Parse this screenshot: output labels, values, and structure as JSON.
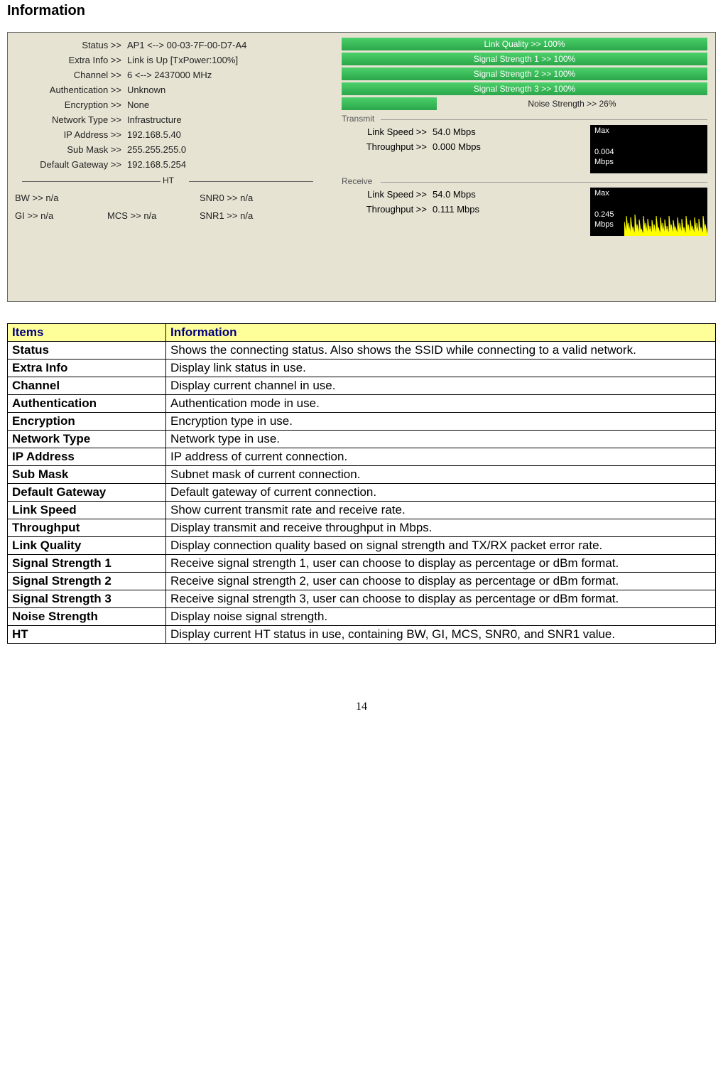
{
  "title": "Information",
  "page_number": "14",
  "screenshot": {
    "left_kv": [
      {
        "label": "Status >>",
        "value": "AP1 <--> 00-03-7F-00-D7-A4"
      },
      {
        "label": "Extra Info >>",
        "value": "Link is Up [TxPower:100%]"
      },
      {
        "label": "Channel >>",
        "value": "6 <--> 2437000 MHz"
      },
      {
        "label": "Authentication >>",
        "value": "Unknown"
      },
      {
        "label": "Encryption >>",
        "value": "None"
      },
      {
        "label": "Network Type >>",
        "value": "Infrastructure"
      },
      {
        "label": "IP Address >>",
        "value": "192.168.5.40"
      },
      {
        "label": "Sub Mask >>",
        "value": "255.255.255.0"
      },
      {
        "label": "Default Gateway >>",
        "value": "192.168.5.254"
      }
    ],
    "ht_label": "HT",
    "ht": {
      "bw": {
        "label": "BW >>",
        "value": "n/a"
      },
      "snr0": {
        "label": "SNR0 >>",
        "value": "n/a"
      },
      "gi": {
        "label": "GI >>",
        "value": "n/a"
      },
      "mcs": {
        "label": "MCS >>",
        "value": "n/a"
      },
      "snr1": {
        "label": "SNR1 >>",
        "value": "n/a"
      }
    },
    "bars": {
      "link_quality": "Link Quality >> 100%",
      "sig1": "Signal Strength 1 >> 100%",
      "sig2": "Signal Strength 2 >> 100%",
      "sig3": "Signal Strength 3 >> 100%",
      "noise": "Noise Strength >> 26%"
    },
    "transmit": {
      "legend": "Transmit",
      "link_speed": {
        "label": "Link Speed >>",
        "value": "54.0 Mbps"
      },
      "throughput": {
        "label": "Throughput >>",
        "value": "0.000 Mbps"
      },
      "chart": {
        "max": "Max",
        "value": "0.004",
        "unit": "Mbps"
      }
    },
    "receive": {
      "legend": "Receive",
      "link_speed": {
        "label": "Link Speed >>",
        "value": "54.0 Mbps"
      },
      "throughput": {
        "label": "Throughput >>",
        "value": "0.111 Mbps"
      },
      "chart": {
        "max": "Max",
        "value": "0.245",
        "unit": "Mbps"
      }
    }
  },
  "table": {
    "header": {
      "items": "Items",
      "info": "Information"
    },
    "rows": [
      {
        "item": "Status",
        "info": "Shows the connecting status. Also shows the SSID while connecting to a valid network.",
        "justify": false
      },
      {
        "item": "Extra Info",
        "info": "Display link status in use.",
        "justify": false
      },
      {
        "item": "Channel",
        "info": "Display current channel in use.",
        "justify": false
      },
      {
        "item": "Authentication",
        "info": "Authentication mode in use.",
        "justify": false
      },
      {
        "item": "Encryption",
        "info": "Encryption type in use.",
        "justify": false
      },
      {
        "item": "Network Type",
        "info": "Network type in use.",
        "justify": false
      },
      {
        "item": "IP Address",
        "info": "IP address of current connection.",
        "justify": false
      },
      {
        "item": "Sub Mask",
        "info": "Subnet mask of current connection.",
        "justify": false
      },
      {
        "item": "Default Gateway",
        "info": "Default gateway of current connection.",
        "justify": false
      },
      {
        "item": "Link Speed",
        "info": "Show current transmit rate and receive rate.",
        "justify": false
      },
      {
        "item": "Throughput",
        "info": "Display transmit and receive throughput in Mbps.",
        "justify": false
      },
      {
        "item": "Link Quality",
        "info": "Display connection quality based on signal strength and TX/RX packet error rate.",
        "justify": true
      },
      {
        "item": "Signal Strength 1",
        "info": "Receive signal strength 1, user can choose to display as percentage or dBm format.",
        "justify": true
      },
      {
        "item": "Signal Strength 2",
        "info": "Receive signal strength 2, user can choose to display as percentage or dBm format.",
        "justify": true
      },
      {
        "item": "Signal Strength 3",
        "info": "Receive signal strength 3, user can choose to display as percentage or dBm format.",
        "justify": true
      },
      {
        "item": "Noise Strength",
        "info": "Display noise signal strength.",
        "justify": false
      },
      {
        "item": "HT",
        "info": "Display current HT status in use, containing BW, GI, MCS, SNR0, and SNR1 value.",
        "justify": true
      }
    ]
  }
}
